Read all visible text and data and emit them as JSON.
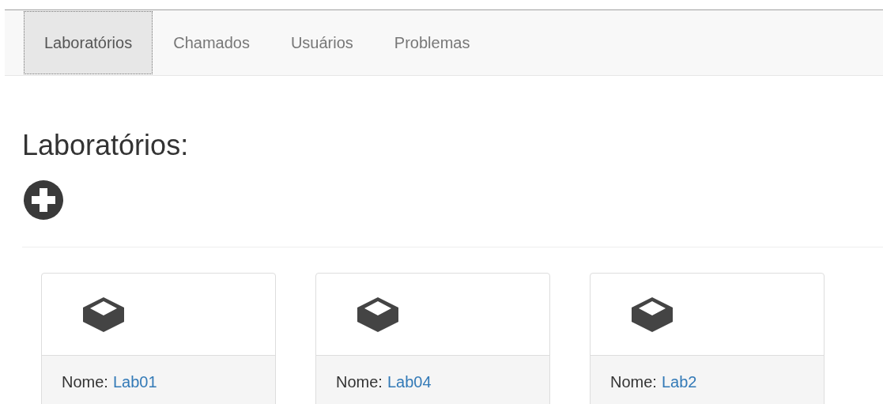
{
  "nav": {
    "tabs": [
      {
        "label": "Laboratórios",
        "selected": true
      },
      {
        "label": "Chamados",
        "selected": false
      },
      {
        "label": "Usuários",
        "selected": false
      },
      {
        "label": "Problemas",
        "selected": false
      }
    ]
  },
  "heading": "Laboratórios:",
  "labs": [
    {
      "label": "Nome:",
      "name": "Lab01"
    },
    {
      "label": "Nome:",
      "name": "Lab04"
    },
    {
      "label": "Nome:",
      "name": "Lab2"
    }
  ]
}
